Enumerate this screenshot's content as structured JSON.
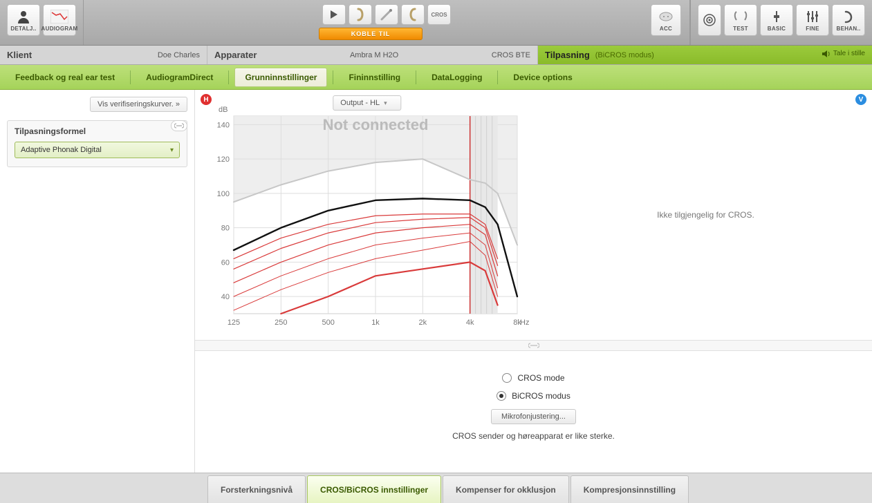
{
  "toolbar": {
    "left": {
      "detaljer": "DETALJ..",
      "audiogram": "AUDIOGRAM"
    },
    "center": {
      "cros": "CROS",
      "koble_til": "KOBLE TIL",
      "acc": "ACC"
    },
    "right": {
      "test": "TEST",
      "basic": "BASIC",
      "fine": "FINE",
      "behandle": "BEHAN.."
    }
  },
  "info": {
    "klient_label": "Klient",
    "klient_value": "Doe Charles",
    "apparater_label": "Apparater",
    "apparater_model": "Ambra M H2O",
    "apparater_type": "CROS BTE",
    "tilpasning_label": "Tilpasning",
    "tilpasning_mode": "(BiCROS modus)",
    "tale": "Tale i stille"
  },
  "green_tabs": {
    "items": [
      "Feedback og real ear test",
      "AudiogramDirect",
      "Grunninnstillinger",
      "Fininnstilling",
      "DataLogging",
      "Device options"
    ],
    "active_index": 2
  },
  "side": {
    "vis_btn": "Vis verifiseringskurver.  »",
    "panel_title": "Tilpasningsformel",
    "formula_selected": "Adaptive Phonak Digital"
  },
  "chart": {
    "output_dd": "Output - HL",
    "not_connected": "Not connected",
    "y_label": "dB",
    "x_label": "Hz",
    "right_msg": "Ikke tilgjengelig for CROS.",
    "badge_h": "H",
    "badge_v": "V"
  },
  "chart_data": {
    "type": "line",
    "xlabel": "Hz",
    "ylabel": "dB",
    "x_ticks": [
      125,
      250,
      500,
      1000,
      2000,
      4000,
      8000
    ],
    "x_tick_labels": [
      "125",
      "250",
      "500",
      "1k",
      "2k",
      "4k",
      "8k"
    ],
    "y_ticks": [
      40,
      60,
      80,
      100,
      120,
      140
    ],
    "ylim": [
      30,
      145
    ],
    "overlay_text": "Not connected",
    "marker_freq": 4000,
    "series": [
      {
        "name": "upper_gray",
        "color": "#c7c7c7",
        "width": 2,
        "x": [
          125,
          250,
          500,
          1000,
          2000,
          4000,
          5000,
          6000,
          8000
        ],
        "y": [
          95,
          105,
          113,
          118,
          120,
          108,
          106,
          100,
          70
        ]
      },
      {
        "name": "black_mpo",
        "color": "#111",
        "width": 2.4,
        "x": [
          125,
          250,
          500,
          1000,
          2000,
          4000,
          5000,
          6000,
          8000
        ],
        "y": [
          67,
          80,
          90,
          96,
          97,
          96,
          92,
          82,
          40
        ]
      },
      {
        "name": "red_1",
        "color": "#d93a3a",
        "width": 1.2,
        "x": [
          125,
          250,
          500,
          1000,
          2000,
          4000,
          5000,
          6000
        ],
        "y": [
          62,
          74,
          82,
          87,
          88,
          88,
          82,
          62
        ]
      },
      {
        "name": "red_2",
        "color": "#d93a3a",
        "width": 1.2,
        "x": [
          125,
          250,
          500,
          1000,
          2000,
          4000,
          5000,
          6000
        ],
        "y": [
          56,
          68,
          77,
          83,
          85,
          86,
          80,
          58
        ]
      },
      {
        "name": "red_3",
        "color": "#d93a3a",
        "width": 1.2,
        "x": [
          125,
          250,
          500,
          1000,
          2000,
          4000,
          5000,
          6000
        ],
        "y": [
          48,
          60,
          70,
          77,
          80,
          82,
          76,
          52
        ]
      },
      {
        "name": "red_4",
        "color": "#d93a3a",
        "width": 1.0,
        "x": [
          125,
          250,
          500,
          1000,
          2000,
          4000,
          5000,
          6000
        ],
        "y": [
          40,
          52,
          62,
          70,
          74,
          77,
          70,
          45
        ]
      },
      {
        "name": "red_5",
        "color": "#d93a3a",
        "width": 1.0,
        "x": [
          125,
          250,
          500,
          1000,
          2000,
          4000,
          5000,
          6000
        ],
        "y": [
          32,
          44,
          54,
          62,
          67,
          72,
          64,
          40
        ]
      },
      {
        "name": "red_bold_low",
        "color": "#d93a3a",
        "width": 2.2,
        "x": [
          250,
          500,
          1000,
          2000,
          4000,
          5000,
          6000
        ],
        "y": [
          30,
          40,
          52,
          56,
          60,
          55,
          35
        ]
      }
    ]
  },
  "controls": {
    "option_cros": "CROS mode",
    "option_bicros": "BiCROS modus",
    "selected": "bicros",
    "mik_btn": "Mikrofonjustering...",
    "hint": "CROS sender og høreapparat er like sterke."
  },
  "bottom_tabs": {
    "items": [
      "Forsterkningsnivå",
      "CROS/BiCROS innstillinger",
      "Kompenser for okklusjon",
      "Kompresjonsinnstilling"
    ],
    "active_index": 1
  }
}
